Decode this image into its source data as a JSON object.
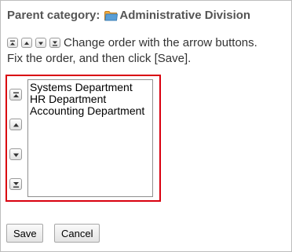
{
  "parent": {
    "label": "Parent category:",
    "value": "Administrative Division",
    "icon": "folder-icon"
  },
  "instructions": {
    "line1": "Change order with the arrow buttons.",
    "line2": "Fix the order, and then click [Save]."
  },
  "order_buttons": {
    "top": "move-to-top-icon",
    "up": "move-up-icon",
    "down": "move-down-icon",
    "bottom": "move-to-bottom-icon"
  },
  "categories": [
    "Systems Department",
    "HR Department",
    "Accounting Department"
  ],
  "actions": {
    "save_label": "Save",
    "cancel_label": "Cancel"
  },
  "colors": {
    "highlight_border": "#d9000f",
    "folder": "#5a9fd6"
  }
}
